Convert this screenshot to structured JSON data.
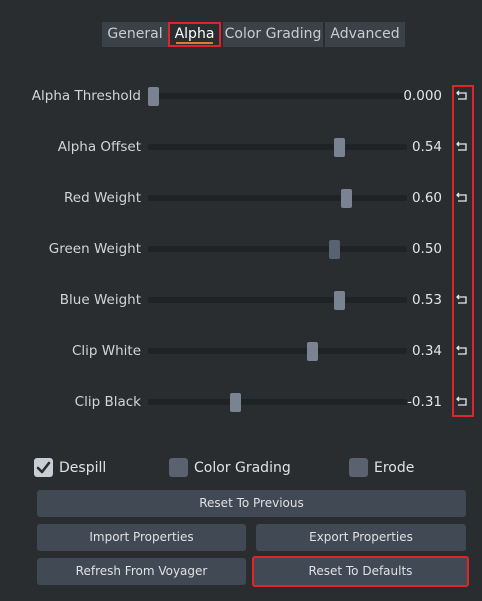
{
  "tabs": [
    {
      "label": "General",
      "active": false
    },
    {
      "label": "Alpha",
      "active": true
    },
    {
      "label": "Color Grading",
      "active": false
    },
    {
      "label": "Advanced",
      "active": false
    }
  ],
  "sliders": [
    {
      "label": "Alpha Threshold",
      "value": "0.000",
      "level": 0.0,
      "reset_icon": true
    },
    {
      "label": "Alpha Offset",
      "value": "0.54",
      "level": 0.75,
      "reset_icon": true
    },
    {
      "label": "Red Weight",
      "value": "0.60",
      "level": 0.78,
      "reset_icon": true
    },
    {
      "label": "Green Weight",
      "value": "0.50",
      "level": 0.73,
      "reset_icon": false
    },
    {
      "label": "Blue Weight",
      "value": "0.53",
      "level": 0.75,
      "reset_icon": true
    },
    {
      "label": "Clip White",
      "value": "0.34",
      "level": 0.64,
      "reset_icon": true
    },
    {
      "label": "Clip Black",
      "value": "-0.31",
      "level": 0.33,
      "reset_icon": true
    }
  ],
  "checkboxes": [
    {
      "label": "Despill",
      "checked": true
    },
    {
      "label": "Color Grading",
      "checked": false
    },
    {
      "label": "Erode",
      "checked": false
    }
  ],
  "buttons": {
    "reset_previous": "Reset To Previous",
    "import_properties": "Import Properties",
    "export_properties": "Export Properties",
    "refresh_voyager": "Refresh From Voyager",
    "reset_defaults": "Reset To Defaults"
  },
  "icons": {
    "reset": "reset-arrow-icon",
    "check": "checkmark-icon"
  },
  "colors": {
    "background": "#2a2d30",
    "highlight": "#e0242a",
    "tab_underline": "#e07b28"
  }
}
